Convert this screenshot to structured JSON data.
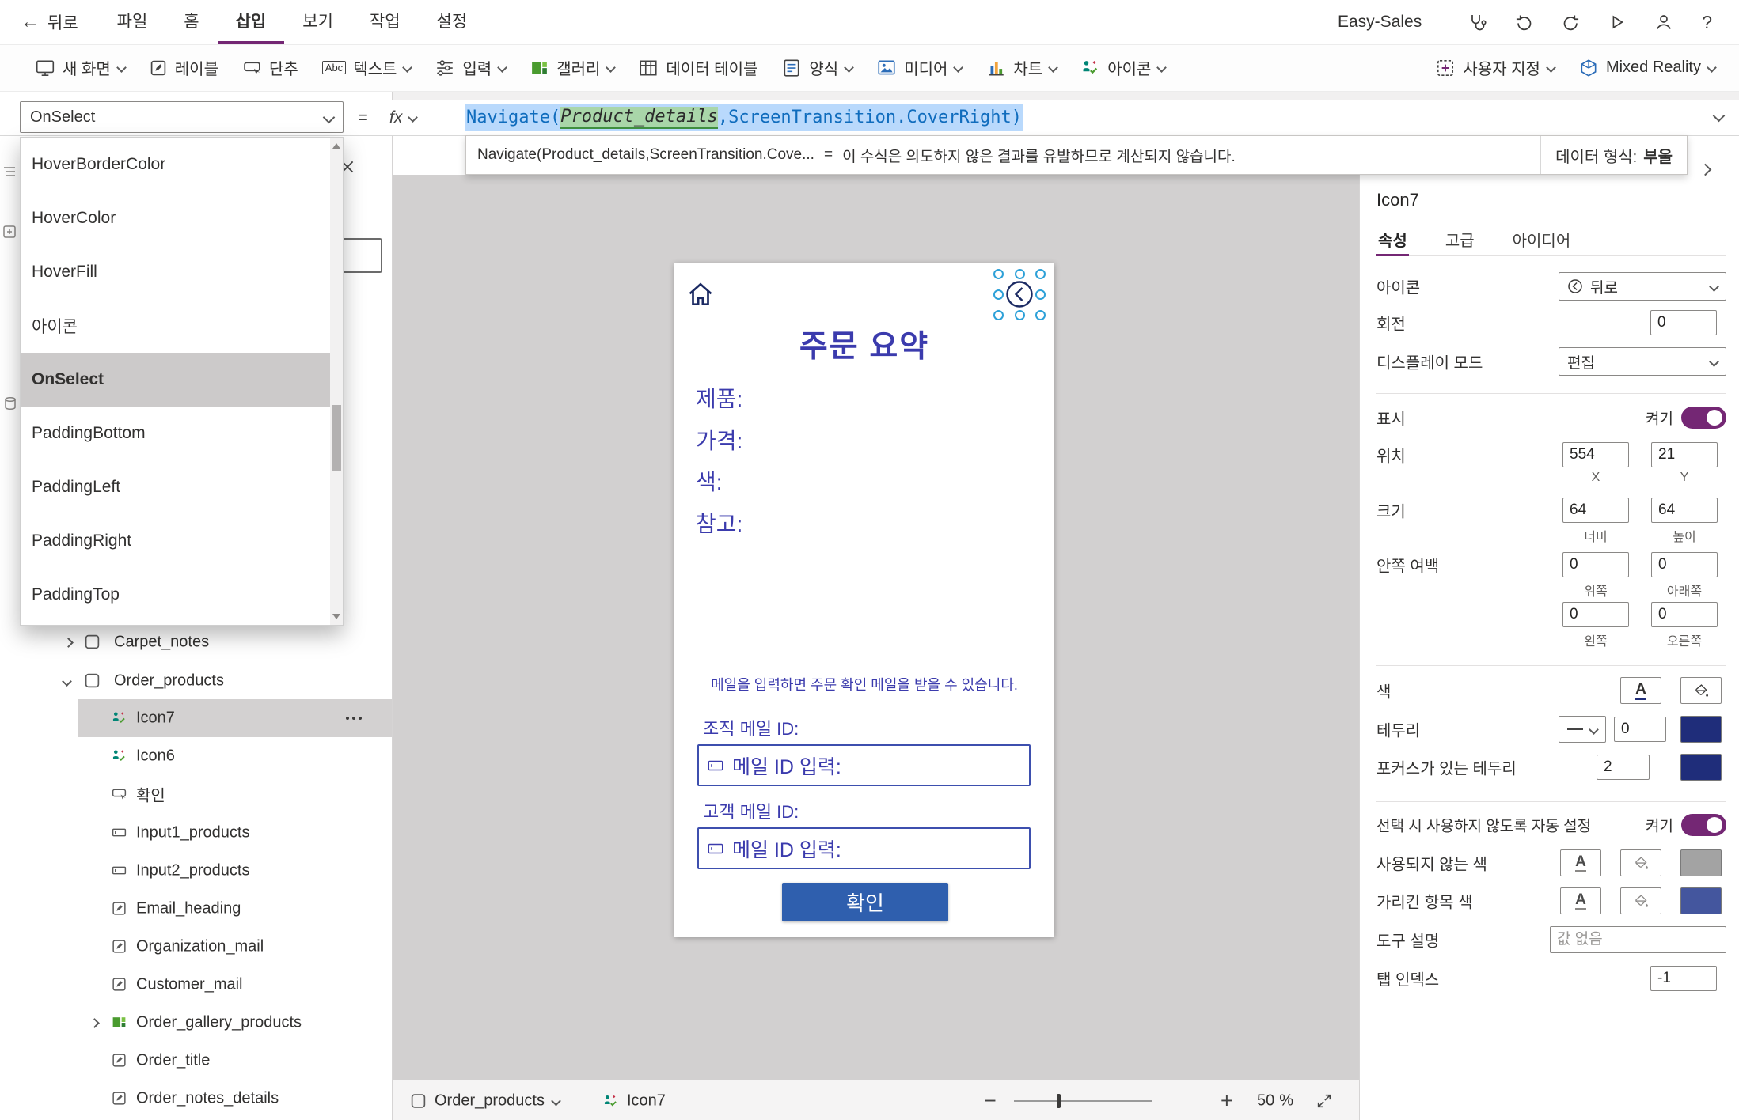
{
  "colors": {
    "accent": "#742774",
    "canvas_navy": "#3b3bad",
    "confirm_blue": "#2f5fae",
    "border_swatch": "#1f2d7a",
    "focused_border_swatch": "#1f2d7a",
    "hover_swatch": "#44569e",
    "disabled_swatch": "#a3a3a3"
  },
  "glyphs": {
    "font_color": "A",
    "text_icon": "Abc",
    "help": "?"
  },
  "topbar": {
    "back_label": "뒤로",
    "menus": [
      {
        "label": "파일"
      },
      {
        "label": "홈"
      },
      {
        "label": "삽입"
      },
      {
        "label": "보기"
      },
      {
        "label": "작업"
      },
      {
        "label": "설정"
      }
    ],
    "app_name": "Easy-Sales"
  },
  "ribbon": {
    "items": [
      {
        "label": "새 화면"
      },
      {
        "label": "레이블"
      },
      {
        "label": "단추"
      },
      {
        "label": "텍스트"
      },
      {
        "label": "입력"
      },
      {
        "label": "갤러리"
      },
      {
        "label": "데이터 테이블"
      },
      {
        "label": "양식"
      },
      {
        "label": "미디어"
      },
      {
        "label": "차트"
      },
      {
        "label": "아이콘"
      },
      {
        "label": "사용자 지정"
      },
      {
        "label": "Mixed Reality"
      }
    ]
  },
  "formula_bar": {
    "property": "OnSelect",
    "equals": "=",
    "fx": "fx",
    "code_prefix": "Navigate(",
    "code_token": "Product_details",
    "code_suffix": ",ScreenTransition.CoverRight)"
  },
  "warning": {
    "formula_truncated": "Navigate(Product_details,ScreenTransition.Cove...",
    "equals": "=",
    "message": "이 수식은 의도하지 않은 결과를 유발하므로 계산되지 않습니다.",
    "data_type_label": "데이터 형식:",
    "data_type_value": "부울"
  },
  "property_dropdown": {
    "items": [
      {
        "label": "HoverBorderColor"
      },
      {
        "label": "HoverColor"
      },
      {
        "label": "HoverFill"
      },
      {
        "label": "아이콘"
      },
      {
        "label": "OnSelect"
      },
      {
        "label": "PaddingBottom"
      },
      {
        "label": "PaddingLeft"
      },
      {
        "label": "PaddingRight"
      },
      {
        "label": "PaddingTop"
      }
    ],
    "selected": "OnSelect"
  },
  "tree": {
    "items": [
      {
        "label": "Carpet_notes"
      },
      {
        "label": "Order_products"
      },
      {
        "label": "Icon7"
      },
      {
        "label": "Icon6"
      },
      {
        "label": "확인"
      },
      {
        "label": "Input1_products"
      },
      {
        "label": "Input2_products"
      },
      {
        "label": "Email_heading"
      },
      {
        "label": "Organization_mail"
      },
      {
        "label": "Customer_mail"
      },
      {
        "label": "Order_gallery_products"
      },
      {
        "label": "Order_title"
      },
      {
        "label": "Order_notes_details"
      }
    ]
  },
  "canvas": {
    "title": "주문 요약",
    "field_labels": [
      {
        "label": "제품:"
      },
      {
        "label": "가격:"
      },
      {
        "label": "색:"
      },
      {
        "label": "참고:"
      }
    ],
    "email_note": "메일을 입력하면 주문 확인 메일을 받을 수 있습니다.",
    "org_mail_label": "조직 메일 ID:",
    "org_mail_placeholder": "메일 ID 입력:",
    "customer_mail_label": "고객 메일 ID:",
    "customer_mail_placeholder": "메일 ID 입력:",
    "confirm_button": "확인"
  },
  "properties_panel": {
    "title": "Icon7",
    "tabs": [
      {
        "label": "속성"
      },
      {
        "label": "고급"
      },
      {
        "label": "아이디어"
      }
    ],
    "rows": {
      "icon": {
        "label": "아이콘",
        "value": "뒤로"
      },
      "rotation": {
        "label": "회전",
        "value": "0"
      },
      "display_mode": {
        "label": "디스플레이 모드",
        "value": "편집"
      },
      "visible": {
        "label": "표시",
        "state": "켜기"
      },
      "position": {
        "label": "위치",
        "x": "554",
        "y": "21",
        "x_label": "X",
        "y_label": "Y"
      },
      "size": {
        "label": "크기",
        "width": "64",
        "height": "64",
        "width_label": "너비",
        "height_label": "높이"
      },
      "padding": {
        "label": "안쪽 여백",
        "top": "0",
        "bottom": "0",
        "left": "0",
        "right": "0",
        "top_label": "위쪽",
        "bottom_label": "아래쪽",
        "left_label": "왼쪽",
        "right_label": "오른쪽"
      },
      "color": {
        "label": "색"
      },
      "border": {
        "label": "테두리",
        "weight": "0"
      },
      "focused_border": {
        "label": "포커스가 있는 테두리",
        "value": "2"
      },
      "auto_disable": {
        "label": "선택 시 사용하지 않도록 자동 설정",
        "state": "켜기"
      },
      "disabled_color": {
        "label": "사용되지 않는 색"
      },
      "hover_color": {
        "label": "가리킨 항목 색"
      },
      "tooltip": {
        "label": "도구 설명",
        "placeholder": "값 없음"
      },
      "tab_index": {
        "label": "탭 인덱스",
        "value": "-1"
      }
    }
  },
  "bottom_bar": {
    "screen_name": "Order_products",
    "control_name": "Icon7",
    "zoom_value": "50",
    "zoom_unit": "%"
  }
}
